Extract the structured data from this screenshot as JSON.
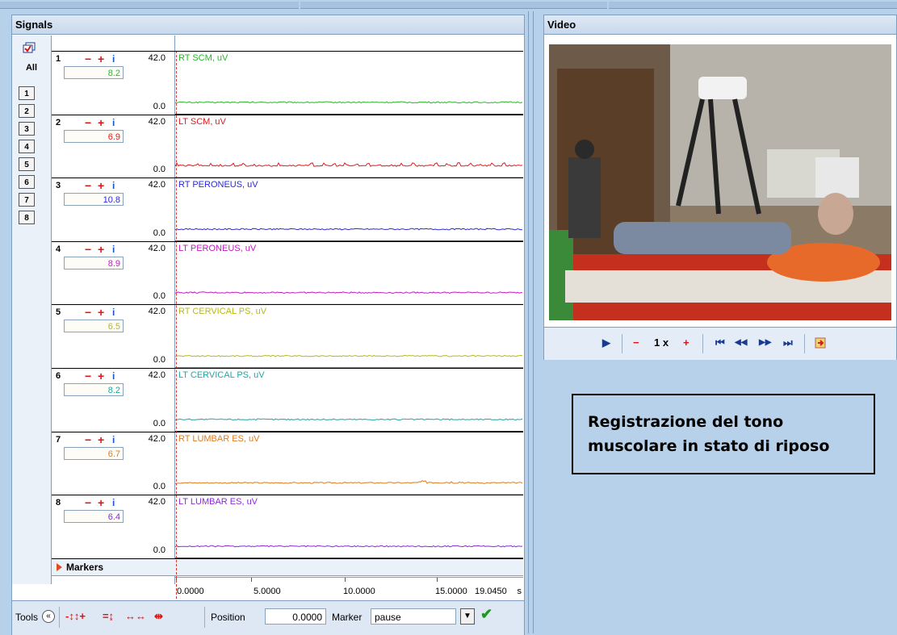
{
  "signals": {
    "title": "Signals",
    "all_label": "All",
    "channel_buttons": [
      "1",
      "2",
      "3",
      "4",
      "5",
      "6",
      "7",
      "8"
    ],
    "scale_max": "42.0",
    "scale_min": "0.0",
    "channels": [
      {
        "num": "1",
        "value": "8.2",
        "label": "RT SCM, uV",
        "color": "#2bb52b"
      },
      {
        "num": "2",
        "value": "6.9",
        "label": "LT SCM, uV",
        "color": "#e01a1a"
      },
      {
        "num": "3",
        "value": "10.8",
        "label": "RT PERONEUS, uV",
        "color": "#2a2ad8"
      },
      {
        "num": "4",
        "value": "8.9",
        "label": "LT PERONEUS, uV",
        "color": "#c21ac2"
      },
      {
        "num": "5",
        "value": "6.5",
        "label": "RT CERVICAL PS, uV",
        "color": "#b8b81a"
      },
      {
        "num": "6",
        "value": "8.2",
        "label": "LT CERVICAL PS, uV",
        "color": "#1aa8a8"
      },
      {
        "num": "7",
        "value": "6.7",
        "label": "RT LUMBAR ES, uV",
        "color": "#e07a1a"
      },
      {
        "num": "8",
        "value": "6.4",
        "label": "LT LUMBAR ES, uV",
        "color": "#8a2ad8"
      }
    ],
    "channel_icons": {
      "minus": "−",
      "plus": "+",
      "info": "i"
    },
    "markers_label": "Markers",
    "time_axis": {
      "ticks": [
        "0.0000",
        "5.0000",
        "10.0000",
        "15.0000",
        "19.0450"
      ],
      "unit": "s"
    }
  },
  "tools": {
    "label": "Tools",
    "collapse_glyph": "«",
    "position_label": "Position",
    "position_value": "0.0000",
    "marker_label": "Marker",
    "marker_value": "pause",
    "dropdown_glyph": "▼",
    "confirm_glyph": "✔"
  },
  "video": {
    "title": "Video",
    "speed": "1 x",
    "play_glyph": "▶",
    "minus_glyph": "−",
    "plus_glyph": "+",
    "first_glyph": "⏮",
    "prev_glyph": "◀◀",
    "next_glyph": "▶▶",
    "last_glyph": "⏭"
  },
  "note": {
    "text": "Registrazione del tono muscolare in stato di riposo"
  }
}
